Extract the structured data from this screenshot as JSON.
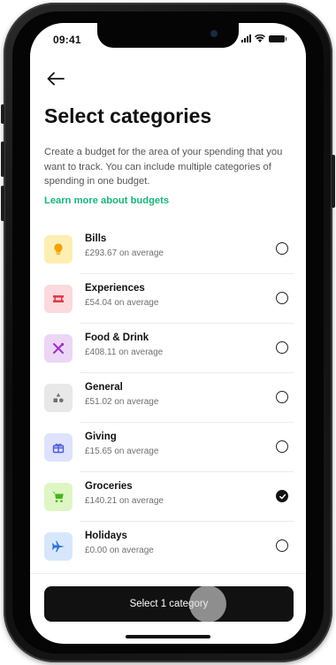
{
  "status_bar": {
    "time": "09:41"
  },
  "header": {
    "back_icon": "arrow-left-icon",
    "title": "Select categories",
    "description": "Create a budget for the area of your spending that you want to track. You can  include multiple categories of spending in one budget.",
    "learn_more_link": "Learn more about budgets"
  },
  "colors": {
    "accent_green": "#19b37a",
    "button_bg": "#111111"
  },
  "categories": [
    {
      "name": "Bills",
      "amount": "£293.67",
      "avg_suffix": "on average",
      "icon": "lightbulb-icon",
      "icon_bg": "#fdeeb2",
      "icon_color": "#f2a100",
      "selected": false
    },
    {
      "name": "Experiences",
      "amount": "£54.04",
      "avg_suffix": "on average",
      "icon": "ticket-icon",
      "icon_bg": "#fbd9dc",
      "icon_color": "#e03b4b",
      "selected": false
    },
    {
      "name": "Food & Drink",
      "amount": "£408.11",
      "avg_suffix": "on average",
      "icon": "cutlery-icon",
      "icon_bg": "#ecd6f6",
      "icon_color": "#9b30c9",
      "selected": false
    },
    {
      "name": "General",
      "amount": "£51.02",
      "avg_suffix": "on average",
      "icon": "shapes-icon",
      "icon_bg": "#e8e8e8",
      "icon_color": "#707070",
      "selected": false
    },
    {
      "name": "Giving",
      "amount": "£15.65",
      "avg_suffix": "on average",
      "icon": "gift-icon",
      "icon_bg": "#dfe2fb",
      "icon_color": "#4f5ad8",
      "selected": false
    },
    {
      "name": "Groceries",
      "amount": "£140.21",
      "avg_suffix": "on average",
      "icon": "shopping-cart-icon",
      "icon_bg": "#def6c4",
      "icon_color": "#45b51e",
      "selected": true
    },
    {
      "name": "Holidays",
      "amount": "£0.00",
      "avg_suffix": "on average",
      "icon": "airplane-icon",
      "icon_bg": "#d7e7fb",
      "icon_color": "#2f73d9",
      "selected": false
    }
  ],
  "footer": {
    "button_label": "Select 1 category"
  }
}
